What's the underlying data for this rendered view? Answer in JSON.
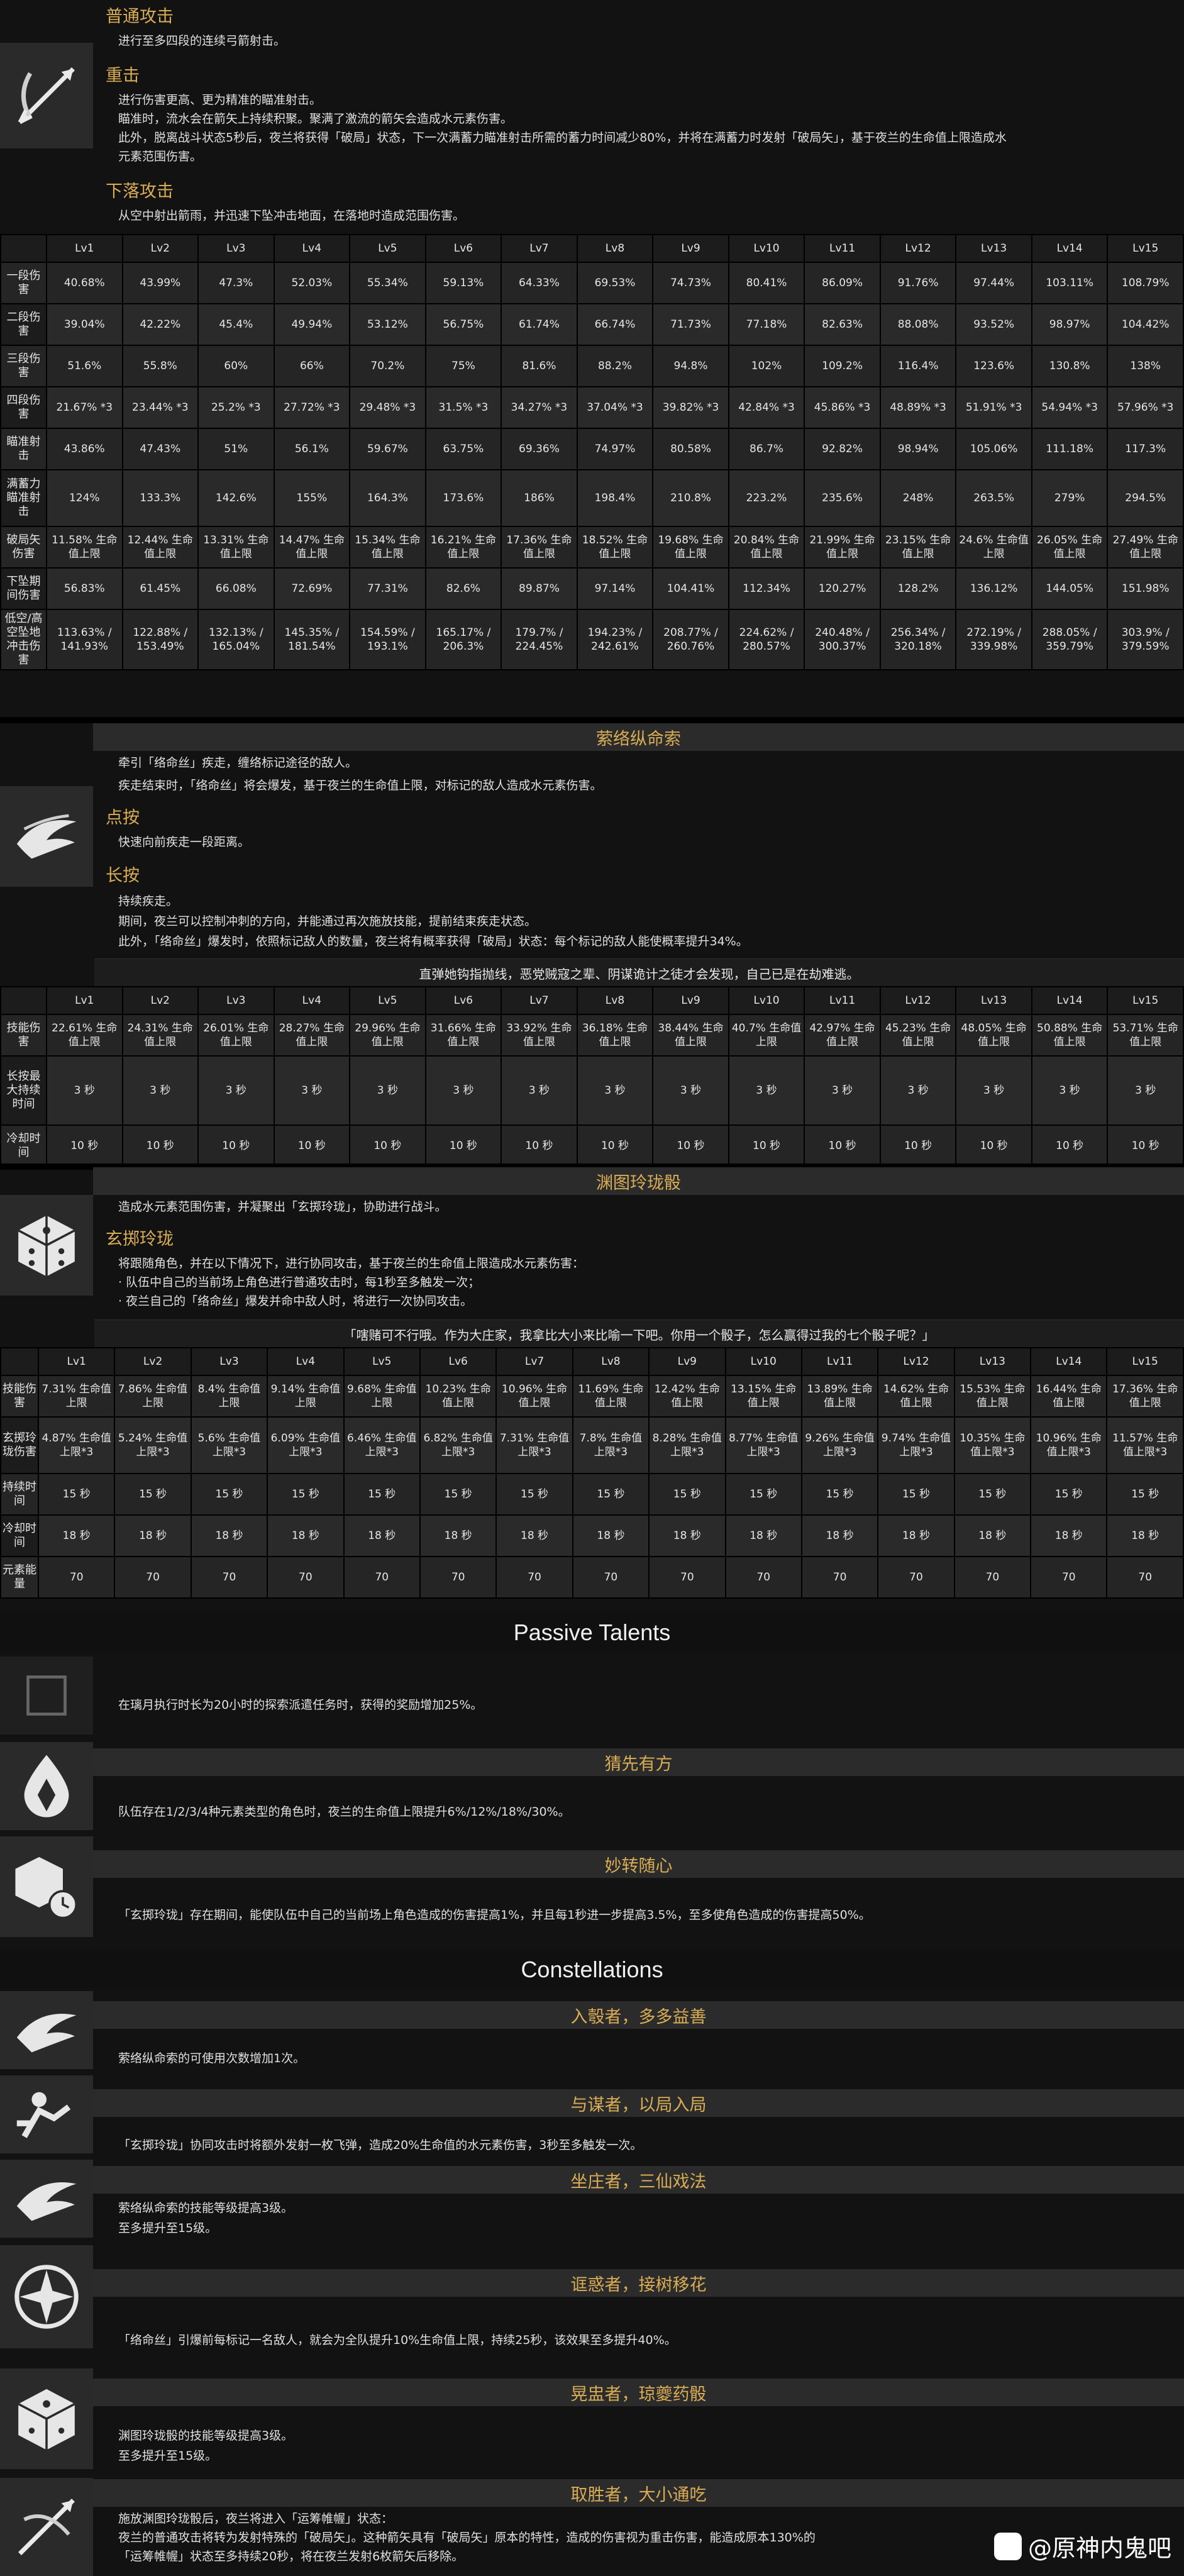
{
  "normal_attack": {
    "normal_label": "普通攻击",
    "normal_desc": "进行至多四段的连续弓箭射击。",
    "charged_label": "重击",
    "charged_lines": [
      "进行伤害更高、更为精准的瞄准射击。",
      "瞄准时，流水会在箭矢上持续积聚。聚满了激流的箭矢会造成水元素伤害。",
      "此外，脱离战斗状态5秒后，夜兰将获得「破局」状态，下一次满蓄力瞄准射击所需的蓄力时间减少80%，并将在满蓄力时发射「破局矢」，基于夜兰的生命值上限造成水",
      "元素范围伤害。"
    ],
    "plunge_label": "下落攻击",
    "plunge_desc": "从空中射出箭雨，并迅速下坠冲击地面，在落地时造成范围伤害。",
    "levels": [
      "Lv1",
      "Lv2",
      "Lv3",
      "Lv4",
      "Lv5",
      "Lv6",
      "Lv7",
      "Lv8",
      "Lv9",
      "Lv10",
      "Lv11",
      "Lv12",
      "Lv13",
      "Lv14",
      "Lv15"
    ],
    "rows": [
      {
        "h": "一段伤害",
        "v": [
          "40.68%",
          "43.99%",
          "47.3%",
          "52.03%",
          "55.34%",
          "59.13%",
          "64.33%",
          "69.53%",
          "74.73%",
          "80.41%",
          "86.09%",
          "91.76%",
          "97.44%",
          "103.11%",
          "108.79%"
        ]
      },
      {
        "h": "二段伤害",
        "v": [
          "39.04%",
          "42.22%",
          "45.4%",
          "49.94%",
          "53.12%",
          "56.75%",
          "61.74%",
          "66.74%",
          "71.73%",
          "77.18%",
          "82.63%",
          "88.08%",
          "93.52%",
          "98.97%",
          "104.42%"
        ]
      },
      {
        "h": "三段伤害",
        "v": [
          "51.6%",
          "55.8%",
          "60%",
          "66%",
          "70.2%",
          "75%",
          "81.6%",
          "88.2%",
          "94.8%",
          "102%",
          "109.2%",
          "116.4%",
          "123.6%",
          "130.8%",
          "138%"
        ]
      },
      {
        "h": "四段伤害",
        "v": [
          "21.67% *3",
          "23.44% *3",
          "25.2% *3",
          "27.72% *3",
          "29.48% *3",
          "31.5% *3",
          "34.27% *3",
          "37.04% *3",
          "39.82% *3",
          "42.84% *3",
          "45.86% *3",
          "48.89% *3",
          "51.91% *3",
          "54.94% *3",
          "57.96% *3"
        ]
      },
      {
        "h": "瞄准射击",
        "v": [
          "43.86%",
          "47.43%",
          "51%",
          "56.1%",
          "59.67%",
          "63.75%",
          "69.36%",
          "74.97%",
          "80.58%",
          "86.7%",
          "92.82%",
          "98.94%",
          "105.06%",
          "111.18%",
          "117.3%"
        ]
      },
      {
        "h": "满蓄力瞄准射击",
        "v": [
          "124%",
          "133.3%",
          "142.6%",
          "155%",
          "164.3%",
          "173.6%",
          "186%",
          "198.4%",
          "210.8%",
          "223.2%",
          "235.6%",
          "248%",
          "263.5%",
          "279%",
          "294.5%"
        ]
      },
      {
        "h": "破局矢伤害",
        "v": [
          "11.58% 生命值上限",
          "12.44% 生命值上限",
          "13.31% 生命值上限",
          "14.47% 生命值上限",
          "15.34% 生命值上限",
          "16.21% 生命值上限",
          "17.36% 生命值上限",
          "18.52% 生命值上限",
          "19.68% 生命值上限",
          "20.84% 生命值上限",
          "21.99% 生命值上限",
          "23.15% 生命值上限",
          "24.6% 生命值上限",
          "26.05% 生命值上限",
          "27.49% 生命值上限"
        ]
      },
      {
        "h": "下坠期间伤害",
        "v": [
          "56.83%",
          "61.45%",
          "66.08%",
          "72.69%",
          "77.31%",
          "82.6%",
          "89.87%",
          "97.14%",
          "104.41%",
          "112.34%",
          "120.27%",
          "128.2%",
          "136.12%",
          "144.05%",
          "151.98%"
        ]
      },
      {
        "h": "低空/高空坠地冲击伤害",
        "v": [
          "113.63% / 141.93%",
          "122.88% / 153.49%",
          "132.13% / 165.04%",
          "145.35% / 181.54%",
          "154.59% / 193.1%",
          "165.17% / 206.3%",
          "179.7% / 224.45%",
          "194.23% / 242.61%",
          "208.77% / 260.76%",
          "224.62% / 280.57%",
          "240.48% / 300.37%",
          "256.34% / 320.18%",
          "272.19% / 339.98%",
          "288.05% / 359.79%",
          "303.9% / 379.59%"
        ]
      }
    ]
  },
  "skill": {
    "title": "萦络纵命索",
    "intro_lines": [
      "牵引「络命丝」疾走，缠络标记途径的敌人。",
      "疾走结束时，「络命丝」将会爆发，基于夜兰的生命值上限，对标记的敌人造成水元素伤害。"
    ],
    "tap_label": "点按",
    "tap_desc": "快速向前疾走一段距离。",
    "hold_label": "长按",
    "hold_lines": [
      "持续疾走。",
      "期间，夜兰可以控制冲刺的方向，并能通过再次施放技能，提前结束疾走状态。",
      "此外，「络命丝」爆发时，依照标记敌人的数量，夜兰将有概率获得「破局」状态：每个标记的敌人能使概率提升34%。"
    ],
    "quote": "直弹她钩指抛线，恶党贼寇之辈、阴谋诡计之徒才会发现，自己已是在劫难逃。",
    "rows": [
      {
        "h": "技能伤害",
        "v": [
          "22.61% 生命值上限",
          "24.31% 生命值上限",
          "26.01% 生命值上限",
          "28.27% 生命值上限",
          "29.96% 生命值上限",
          "31.66% 生命值上限",
          "33.92% 生命值上限",
          "36.18% 生命值上限",
          "38.44% 生命值上限",
          "40.7% 生命值上限",
          "42.97% 生命值上限",
          "45.23% 生命值上限",
          "48.05% 生命值上限",
          "50.88% 生命值上限",
          "53.71% 生命值上限"
        ]
      },
      {
        "h": "长按最大持续时间",
        "v": [
          "3 秒",
          "3 秒",
          "3 秒",
          "3 秒",
          "3 秒",
          "3 秒",
          "3 秒",
          "3 秒",
          "3 秒",
          "3 秒",
          "3 秒",
          "3 秒",
          "3 秒",
          "3 秒",
          "3 秒"
        ]
      },
      {
        "h": "冷却时间",
        "v": [
          "10 秒",
          "10 秒",
          "10 秒",
          "10 秒",
          "10 秒",
          "10 秒",
          "10 秒",
          "10 秒",
          "10 秒",
          "10 秒",
          "10 秒",
          "10 秒",
          "10 秒",
          "10 秒",
          "10 秒"
        ]
      }
    ]
  },
  "burst": {
    "title": "渊图玲珑骰",
    "intro": "造成水元素范围伤害，并凝聚出「玄掷玲珑」，协助进行战斗。",
    "sub_label": "玄掷玲珑",
    "sub_lines": [
      "将跟随角色，并在以下情况下，进行协同攻击，基于夜兰的生命值上限造成水元素伤害：",
      "· 队伍中自己的当前场上角色进行普通攻击时，每1秒至多触发一次；",
      "· 夜兰自己的「络命丝」爆发并命中敌人时，将进行一次协同攻击。"
    ],
    "quote": "「嗐赌可不行哦。作为大庄家，我拿比大小来比喻一下吧。你用一个骰子，怎么赢得过我的七个骰子呢？」",
    "rows": [
      {
        "h": "技能伤害",
        "v": [
          "7.31% 生命值上限",
          "7.86% 生命值上限",
          "8.4% 生命值上限",
          "9.14% 生命值上限",
          "9.68% 生命值上限",
          "10.23% 生命值上限",
          "10.96% 生命值上限",
          "11.69% 生命值上限",
          "12.42% 生命值上限",
          "13.15% 生命值上限",
          "13.89% 生命值上限",
          "14.62% 生命值上限",
          "15.53% 生命值上限",
          "16.44% 生命值上限",
          "17.36% 生命值上限"
        ]
      },
      {
        "h": "玄掷玲珑伤害",
        "v": [
          "4.87% 生命值上限*3",
          "5.24% 生命值上限*3",
          "5.6% 生命值上限*3",
          "6.09% 生命值上限*3",
          "6.46% 生命值上限*3",
          "6.82% 生命值上限*3",
          "7.31% 生命值上限*3",
          "7.8% 生命值上限*3",
          "8.28% 生命值上限*3",
          "8.77% 生命值上限*3",
          "9.26% 生命值上限*3",
          "9.74% 生命值上限*3",
          "10.35% 生命值上限*3",
          "10.96% 生命值上限*3",
          "11.57% 生命值上限*3"
        ]
      },
      {
        "h": "持续时间",
        "v": [
          "15 秒",
          "15 秒",
          "15 秒",
          "15 秒",
          "15 秒",
          "15 秒",
          "15 秒",
          "15 秒",
          "15 秒",
          "15 秒",
          "15 秒",
          "15 秒",
          "15 秒",
          "15 秒",
          "15 秒"
        ]
      },
      {
        "h": "冷却时间",
        "v": [
          "18 秒",
          "18 秒",
          "18 秒",
          "18 秒",
          "18 秒",
          "18 秒",
          "18 秒",
          "18 秒",
          "18 秒",
          "18 秒",
          "18 秒",
          "18 秒",
          "18 秒",
          "18 秒",
          "18 秒"
        ]
      },
      {
        "h": "元素能量",
        "v": [
          "70",
          "70",
          "70",
          "70",
          "70",
          "70",
          "70",
          "70",
          "70",
          "70",
          "70",
          "70",
          "70",
          "70",
          "70"
        ]
      }
    ]
  },
  "passives": {
    "heading": "Passive Talents",
    "p0_desc": "在璃月执行时长为20小时的探索派遣任务时，获得的奖励增加25%。",
    "p1_title": "猜先有方",
    "p1_desc": "队伍存在1/2/3/4种元素类型的角色时，夜兰的生命值上限提升6%/12%/18%/30%。",
    "p2_title": "妙转随心",
    "p2_desc": "「玄掷玲珑」存在期间，能使队伍中自己的当前场上角色造成的伤害提高1%，并且每1秒进一步提高3.5%，至多使角色造成的伤害提高50%。"
  },
  "constellations": {
    "heading": "Constellations",
    "c1_title": "入彀者，多多益善",
    "c1_desc": "萦络纵命索的可使用次数增加1次。",
    "c2_title": "与谋者，以局入局",
    "c2_desc": "「玄掷玲珑」协同攻击时将额外发射一枚飞弹，造成20%生命值的水元素伤害，3秒至多触发一次。",
    "c3_title": "坐庄者，三仙戏法",
    "c3_lines": [
      "萦络纵命索的技能等级提高3级。",
      "至多提升至15级。"
    ],
    "c4_title": "诓惑者，接树移花",
    "c4_desc": "「络命丝」引爆前每标记一名敌人，就会为全队提升10%生命值上限，持续25秒，该效果至多提升40%。",
    "c5_title": "晃盅者，琼夔药骰",
    "c5_lines": [
      "渊图玲珑骰的技能等级提高3级。",
      "至多提升至15级。"
    ],
    "c6_title": "取胜者，大小通吃",
    "c6_lines": [
      "施放渊图玲珑骰后，夜兰将进入「运筹帷幄」状态：",
      "夜兰的普通攻击将转为发射特殊的「破局矢」。这种箭矢具有「破局矢」原本的特性，造成的伤害视为重击伤害，能造成原本130%的",
      "「运筹帷幄」状态至多持续20秒，将在夜兰发射6枚箭矢后移除。"
    ]
  },
  "watermark": "@原神内鬼吧",
  "colors": {
    "gold": "#d9ad55",
    "bg": "#121212",
    "cell": "#2a2a2a"
  }
}
